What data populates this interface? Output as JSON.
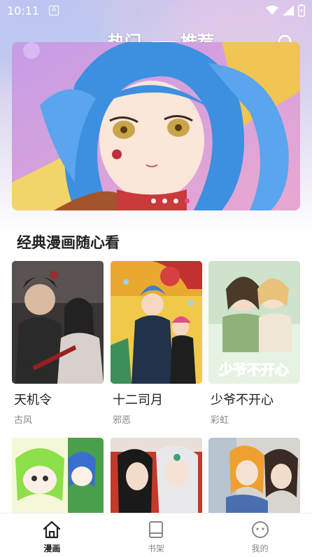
{
  "status_bar": {
    "time": "10:11",
    "notification_letter": "A"
  },
  "header": {
    "tabs": [
      {
        "label": "热门",
        "active": true
      },
      {
        "label": "推荐",
        "active": false
      }
    ],
    "search_icon": "search-icon"
  },
  "banner": {
    "page_count": 4,
    "active_index": 3,
    "accent": "#e84a8a"
  },
  "section": {
    "title": "经典漫画随心看"
  },
  "comics": [
    {
      "title": "天机令",
      "genre": "古风"
    },
    {
      "title": "十二司月",
      "genre": "邪恶"
    },
    {
      "title": "少爷不开心",
      "genre": "彩虹"
    },
    {
      "title": "",
      "genre": ""
    },
    {
      "title": "",
      "genre": ""
    },
    {
      "title": "",
      "genre": ""
    }
  ],
  "cover_art_text": {
    "shaoye": "少爷不开心"
  },
  "bottom_nav": [
    {
      "label": "漫画",
      "icon": "home-icon",
      "active": true
    },
    {
      "label": "书架",
      "icon": "book-icon",
      "active": false
    },
    {
      "label": "我的",
      "icon": "smiley-icon",
      "active": false
    }
  ]
}
